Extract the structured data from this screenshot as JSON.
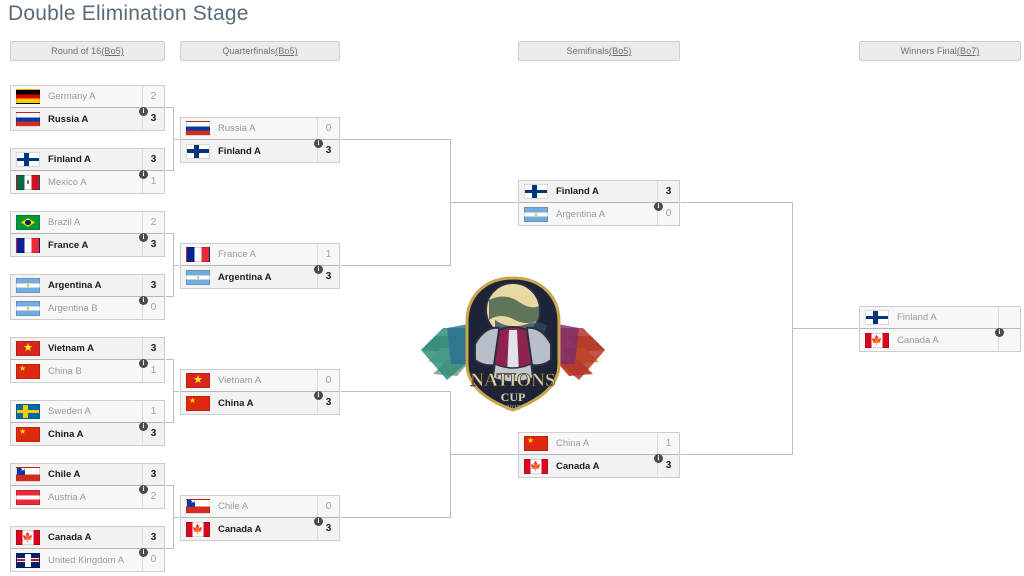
{
  "page": {
    "title": "Double Elimination Stage",
    "logo_alt": "Nations Cup 2023",
    "logo_text_main": "NATIONS",
    "logo_text_sub": "CUP",
    "logo_year": "2023"
  },
  "rounds": [
    {
      "id": "round-of-16",
      "label": "Round of 16 ",
      "format": "(Bo5)"
    },
    {
      "id": "quarterfinals",
      "label": "Quarterfinals ",
      "format": "(Bo5)"
    },
    {
      "id": "semifinals",
      "label": "Semifinals ",
      "format": "(Bo5)"
    },
    {
      "id": "winners-final",
      "label": "Winners Final ",
      "format": "(Bo7)"
    }
  ],
  "info_badge": "i",
  "matches": {
    "r16": [
      {
        "top": {
          "team": "Germany A",
          "score": "2",
          "flag": "f-de",
          "winner": false
        },
        "bottom": {
          "team": "Russia A",
          "score": "3",
          "flag": "f-ru",
          "winner": true
        }
      },
      {
        "top": {
          "team": "Finland A",
          "score": "3",
          "flag": "f-fi",
          "winner": true
        },
        "bottom": {
          "team": "Mexico A",
          "score": "1",
          "flag": "f-mx",
          "winner": false
        }
      },
      {
        "top": {
          "team": "Brazil A",
          "score": "2",
          "flag": "f-br",
          "winner": false
        },
        "bottom": {
          "team": "France A",
          "score": "3",
          "flag": "f-fr",
          "winner": true
        }
      },
      {
        "top": {
          "team": "Argentina A",
          "score": "3",
          "flag": "f-ar",
          "winner": true
        },
        "bottom": {
          "team": "Argentina B",
          "score": "0",
          "flag": "f-ar",
          "winner": false
        }
      },
      {
        "top": {
          "team": "Vietnam A",
          "score": "3",
          "flag": "f-vn",
          "winner": true
        },
        "bottom": {
          "team": "China B",
          "score": "1",
          "flag": "f-cn",
          "winner": false
        }
      },
      {
        "top": {
          "team": "Sweden A",
          "score": "1",
          "flag": "f-se",
          "winner": false
        },
        "bottom": {
          "team": "China A",
          "score": "3",
          "flag": "f-cn",
          "winner": true
        }
      },
      {
        "top": {
          "team": "Chile A",
          "score": "3",
          "flag": "f-cl",
          "winner": true
        },
        "bottom": {
          "team": "Austria A",
          "score": "2",
          "flag": "f-at",
          "winner": false
        }
      },
      {
        "top": {
          "team": "Canada A",
          "score": "3",
          "flag": "f-ca",
          "winner": true
        },
        "bottom": {
          "team": "United Kingdom A",
          "score": "0",
          "flag": "f-gb",
          "winner": false
        }
      }
    ],
    "qf": [
      {
        "top": {
          "team": "Russia A",
          "score": "0",
          "flag": "f-ru",
          "winner": false
        },
        "bottom": {
          "team": "Finland A",
          "score": "3",
          "flag": "f-fi",
          "winner": true
        }
      },
      {
        "top": {
          "team": "France A",
          "score": "1",
          "flag": "f-fr",
          "winner": false
        },
        "bottom": {
          "team": "Argentina A",
          "score": "3",
          "flag": "f-ar",
          "winner": true
        }
      },
      {
        "top": {
          "team": "Vietnam A",
          "score": "0",
          "flag": "f-vn",
          "winner": false
        },
        "bottom": {
          "team": "China A",
          "score": "3",
          "flag": "f-cn",
          "winner": true
        }
      },
      {
        "top": {
          "team": "Chile A",
          "score": "0",
          "flag": "f-cl",
          "winner": false
        },
        "bottom": {
          "team": "Canada A",
          "score": "3",
          "flag": "f-ca",
          "winner": true
        }
      }
    ],
    "sf": [
      {
        "top": {
          "team": "Finland A",
          "score": "3",
          "flag": "f-fi",
          "winner": true
        },
        "bottom": {
          "team": "Argentina A",
          "score": "0",
          "flag": "f-ar",
          "winner": false
        }
      },
      {
        "top": {
          "team": "China A",
          "score": "1",
          "flag": "f-cn",
          "winner": false
        },
        "bottom": {
          "team": "Canada A",
          "score": "3",
          "flag": "f-ca",
          "winner": true
        }
      }
    ],
    "wf": [
      {
        "top": {
          "team": "Finland A",
          "score": "",
          "flag": "f-fi",
          "winner": false
        },
        "bottom": {
          "team": "Canada A",
          "score": "",
          "flag": "f-ca",
          "winner": false
        }
      }
    ]
  }
}
